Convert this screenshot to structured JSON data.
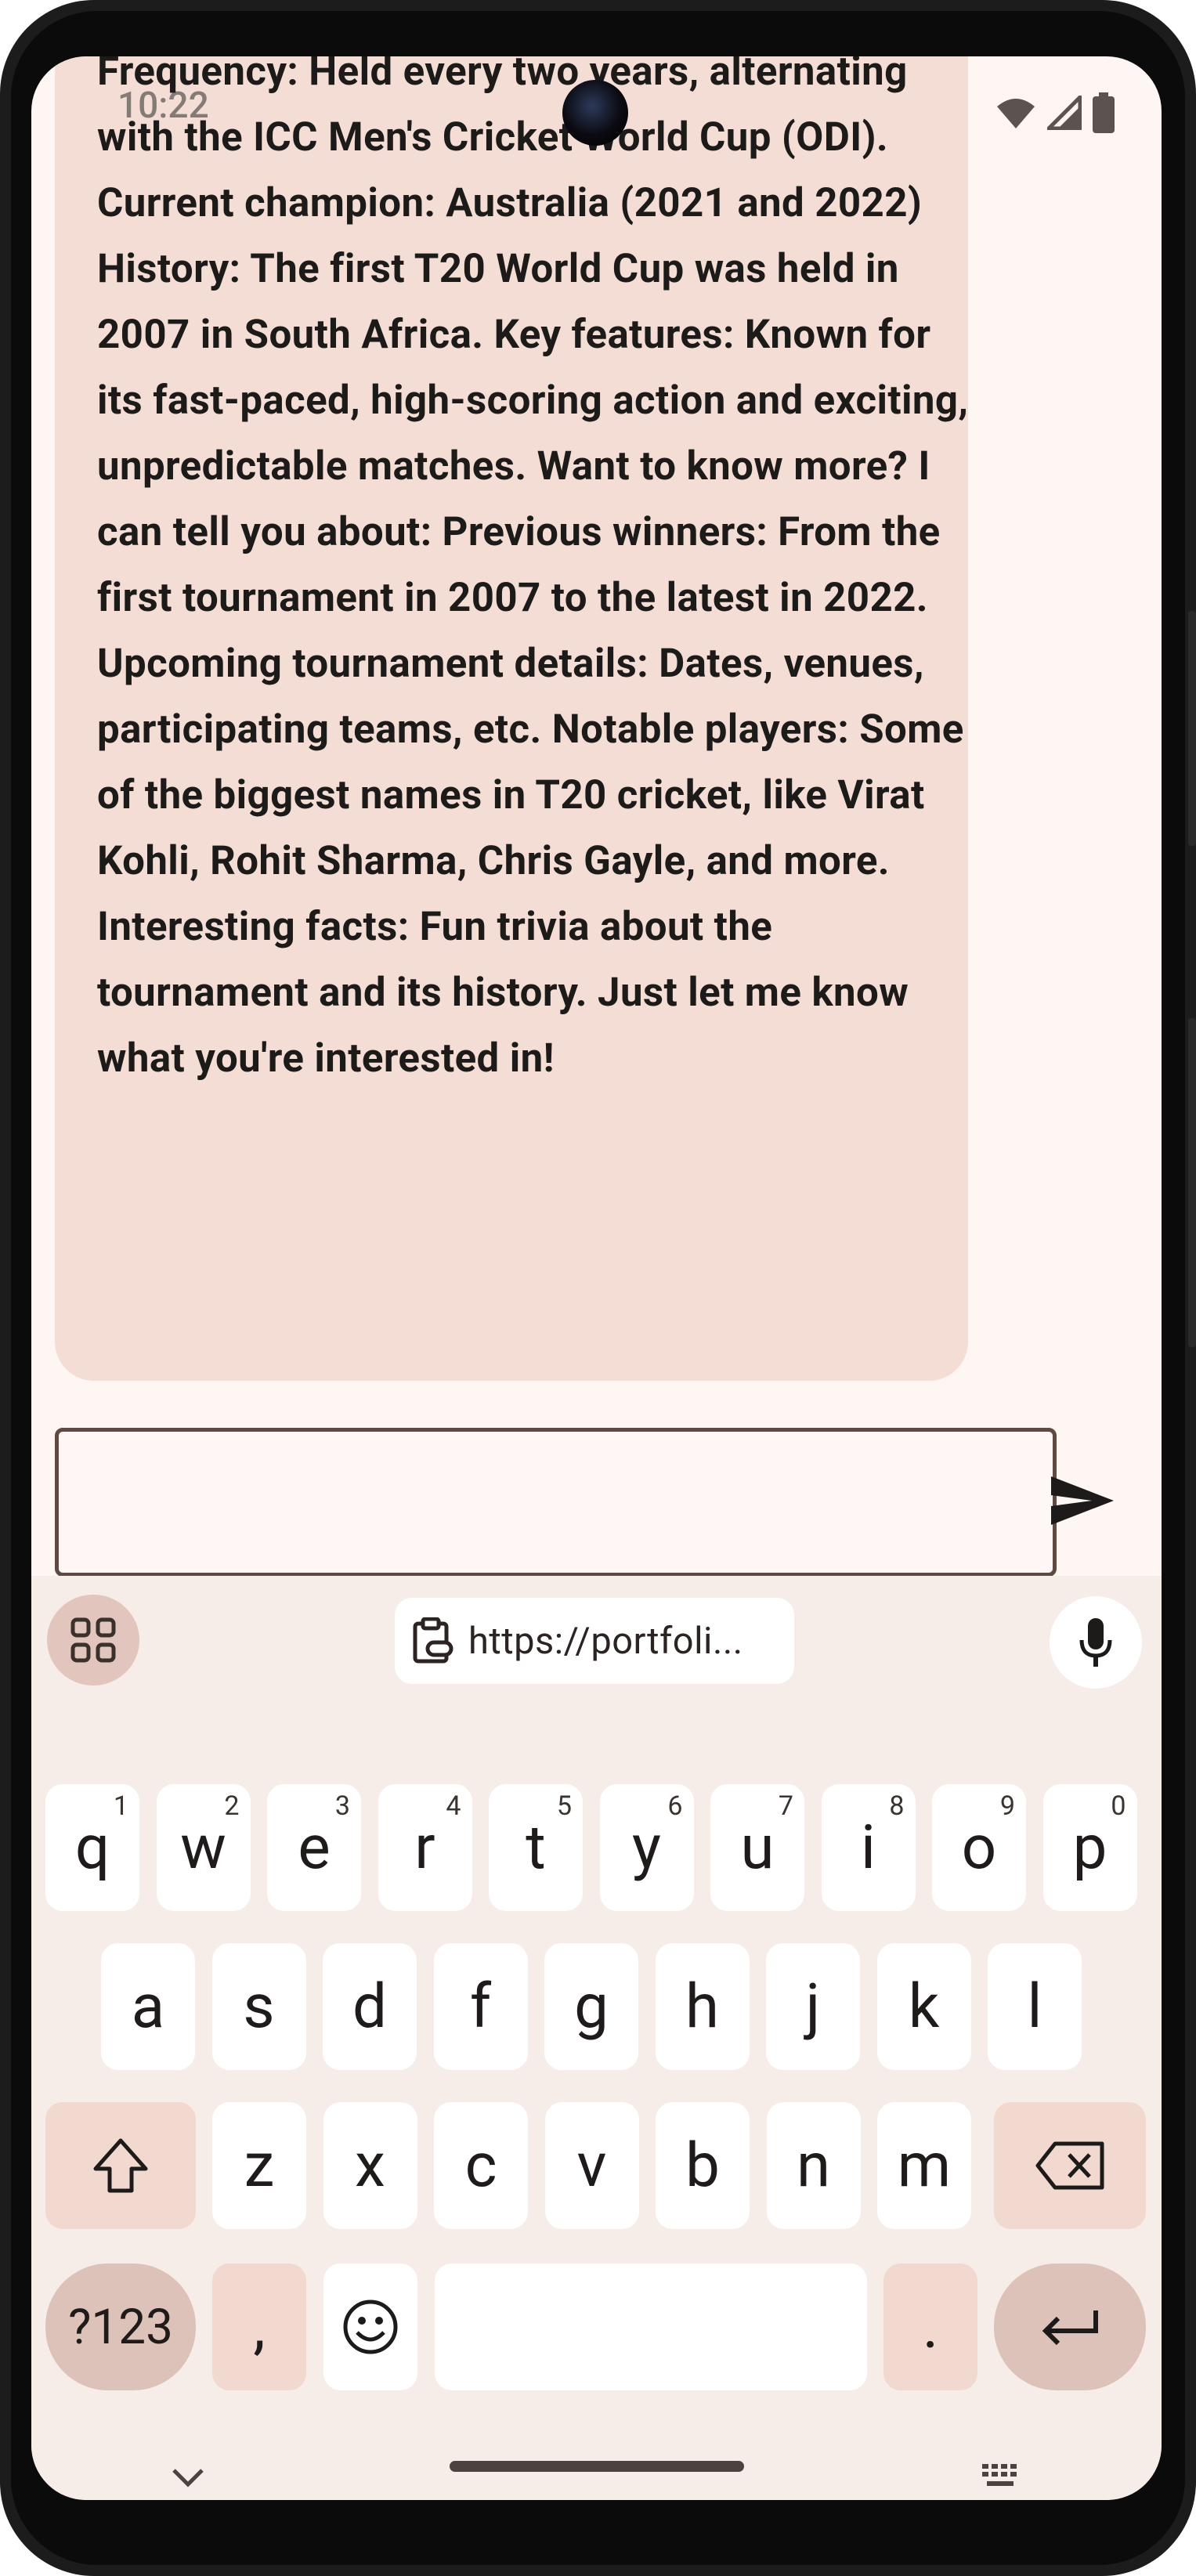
{
  "status_bar": {
    "time": "10:22"
  },
  "chat": {
    "message": "Frequency: Held every two years, alternating with the ICC Men's Cricket World Cup (ODI). Current champion: Australia (2021 and 2022) History: The first T20 World Cup was held in 2007 in South Africa. Key features: Known for its fast-paced, high-scoring action and exciting, unpredictable matches. Want to know more? I can tell you about: Previous winners: From the first tournament in 2007 to the latest in 2022. Upcoming tournament details: Dates, venues, participating teams, etc. Notable players: Some of the biggest names in T20 cricket, like Virat Kohli, Rohit Sharma, Chris Gayle, and more. Interesting facts: Fun trivia about the tournament and its history. Just let me know what you're interested in!"
  },
  "input": {
    "value": "",
    "placeholder": ""
  },
  "keyboard": {
    "clipboard_suggestion": "https://portfoli...",
    "row1": [
      {
        "k": "q",
        "s": "1"
      },
      {
        "k": "w",
        "s": "2"
      },
      {
        "k": "e",
        "s": "3"
      },
      {
        "k": "r",
        "s": "4"
      },
      {
        "k": "t",
        "s": "5"
      },
      {
        "k": "y",
        "s": "6"
      },
      {
        "k": "u",
        "s": "7"
      },
      {
        "k": "i",
        "s": "8"
      },
      {
        "k": "o",
        "s": "9"
      },
      {
        "k": "p",
        "s": "0"
      }
    ],
    "row2": [
      "a",
      "s",
      "d",
      "f",
      "g",
      "h",
      "j",
      "k",
      "l"
    ],
    "row3": [
      "z",
      "x",
      "c",
      "v",
      "b",
      "n",
      "m"
    ],
    "symbols_label": "?123",
    "comma_label": ",",
    "period_label": "."
  },
  "colors": {
    "bubble": "#f3ddd5",
    "screen_bg": "#fdf6f3",
    "keyboard_bg": "#f6ece8",
    "accent_key": "#dcc2b8"
  }
}
